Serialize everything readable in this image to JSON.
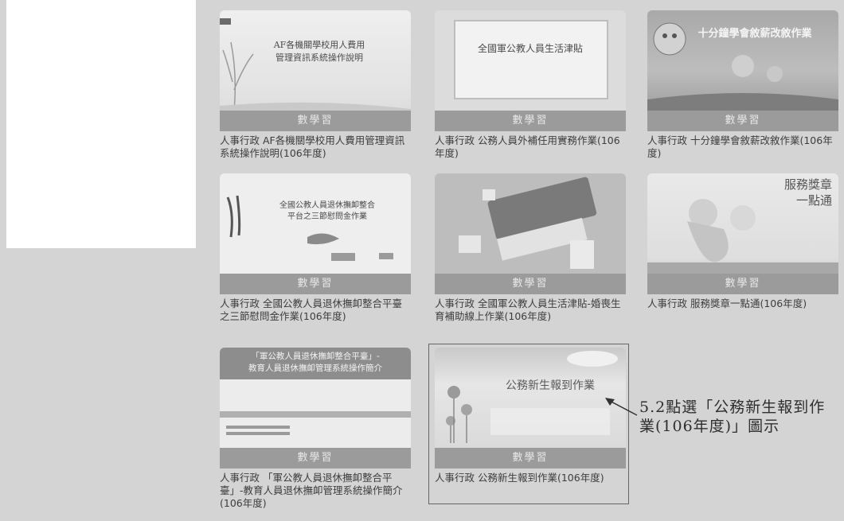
{
  "cards": [
    {
      "title_lines": [
        "AF各機關學校用人費用",
        "管理資訊系統操作說明"
      ],
      "button": "數學習",
      "caption": "人事行政  AF各機關學校用人費用管理資訊系統操作說明(106年度)"
    },
    {
      "title_lines": [
        "全國軍公教人員生活津貼"
      ],
      "button": "數學習",
      "caption": "人事行政  公務人員外補任用實務作業(106年度)"
    },
    {
      "title_lines": [
        "十分鐘學會敘薪改敘作業"
      ],
      "button": "數學習",
      "caption": "人事行政  十分鐘學會敘薪改敘作業(106年度)"
    },
    {
      "title_lines": [
        "全國公教人員退休撫卹整合",
        "平台之三節慰問金作業"
      ],
      "button": "數學習",
      "caption": "人事行政  全國公教人員退休撫卹整合平臺之三節慰問金作業(106年度)"
    },
    {
      "title_lines": [],
      "button": "數學習",
      "caption": "人事行政  全國軍公教人員生活津貼-婚喪生育補助線上作業(106年度)"
    },
    {
      "title_lines": [
        "服務獎章",
        "一點通"
      ],
      "button": "數學習",
      "caption": "人事行政  服務獎章一點通(106年度)"
    },
    {
      "title_lines": [
        "「軍公教人員退休撫卹整合平臺」-",
        "教育人員退休撫卹管理系統操作簡介"
      ],
      "button": "數學習",
      "caption": "人事行政  「軍公教人員退休撫卹整合平臺」-教育人員退休撫卹管理系統操作簡介(106年度)"
    },
    {
      "title_lines": [
        "公務新生報到作業"
      ],
      "button": "數學習",
      "caption": "人事行政  公務新生報到作業(106年度)"
    }
  ],
  "annotation": "5.2點選「公務新生報到作業(106年度)」圖示"
}
